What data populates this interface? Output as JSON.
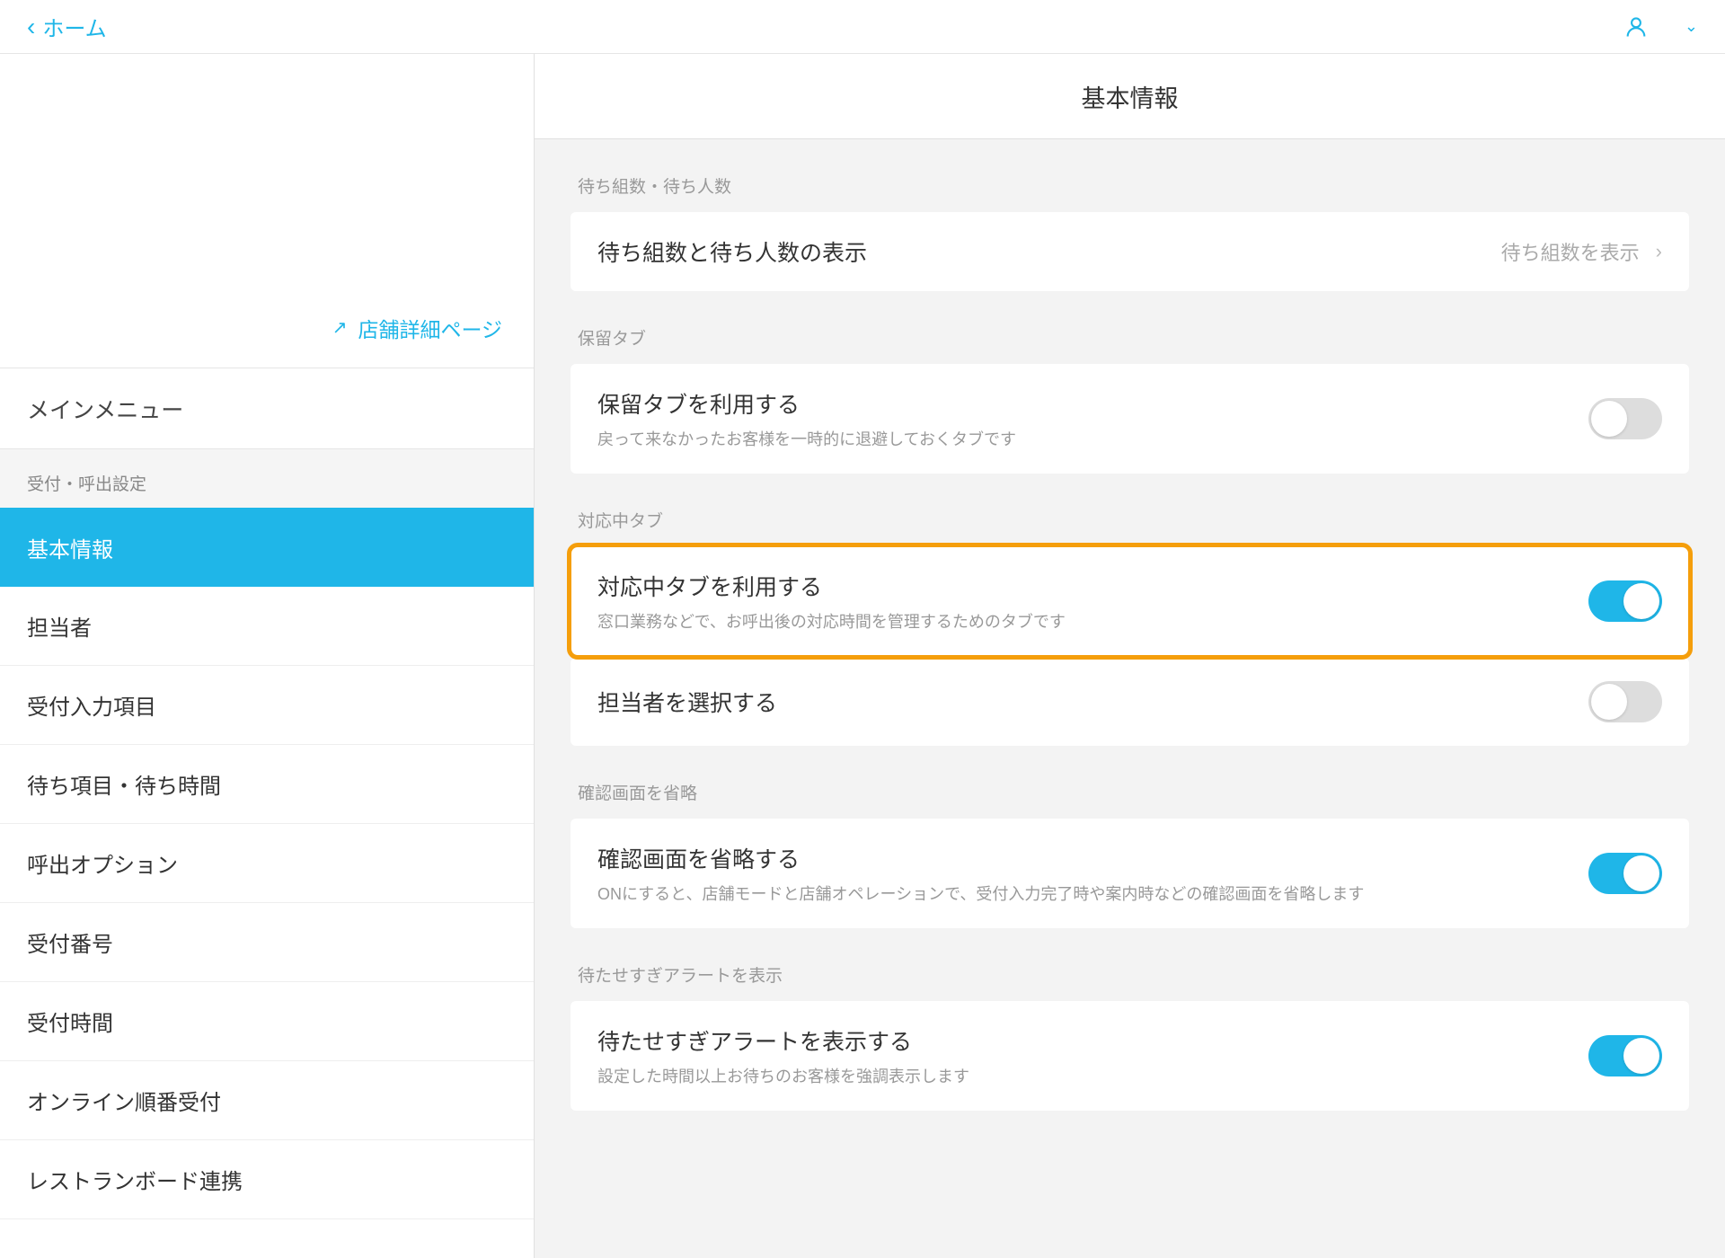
{
  "topbar": {
    "back_label": "ホーム"
  },
  "sidebar": {
    "shop_detail": "店舗詳細ページ",
    "main_menu": "メインメニュー",
    "section_label": "受付・呼出設定",
    "items": [
      {
        "label": "基本情報",
        "active": true
      },
      {
        "label": "担当者",
        "active": false
      },
      {
        "label": "受付入力項目",
        "active": false
      },
      {
        "label": "待ち項目・待ち時間",
        "active": false
      },
      {
        "label": "呼出オプション",
        "active": false
      },
      {
        "label": "受付番号",
        "active": false
      },
      {
        "label": "受付時間",
        "active": false
      },
      {
        "label": "オンライン順番受付",
        "active": false
      },
      {
        "label": "レストランボード連携",
        "active": false
      }
    ]
  },
  "content": {
    "title": "基本情報",
    "groups": [
      {
        "label": "待ち組数・待ち人数",
        "rows": [
          {
            "title": "待ち組数と待ち人数の表示",
            "value": "待ち組数を表示",
            "type": "nav"
          }
        ]
      },
      {
        "label": "保留タブ",
        "rows": [
          {
            "title": "保留タブを利用する",
            "desc": "戻って来なかったお客様を一時的に退避しておくタブです",
            "type": "toggle",
            "on": false
          }
        ]
      },
      {
        "label": "対応中タブ",
        "highlighted": true,
        "rows": [
          {
            "title": "対応中タブを利用する",
            "desc": "窓口業務などで、お呼出後の対応時間を管理するためのタブです",
            "type": "toggle",
            "on": true
          }
        ],
        "extra_rows": [
          {
            "title": "担当者を選択する",
            "type": "toggle",
            "on": false
          }
        ]
      },
      {
        "label": "確認画面を省略",
        "rows": [
          {
            "title": "確認画面を省略する",
            "desc": "ONにすると、店舗モードと店舗オペレーションで、受付入力完了時や案内時などの確認画面を省略します",
            "type": "toggle",
            "on": true
          }
        ]
      },
      {
        "label": "待たせすぎアラートを表示",
        "rows": [
          {
            "title": "待たせすぎアラートを表示する",
            "desc": "設定した時間以上お待ちのお客様を強調表示します",
            "type": "toggle",
            "on": true
          }
        ]
      }
    ]
  }
}
